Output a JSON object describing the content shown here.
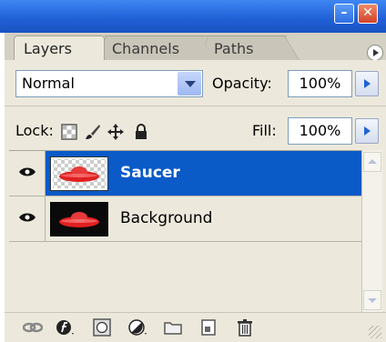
{
  "window": {
    "minimize_glyph": "–",
    "close_glyph": "✕"
  },
  "tabs": [
    {
      "label": "Layers",
      "active": true
    },
    {
      "label": "Channels",
      "active": false
    },
    {
      "label": "Paths",
      "active": false
    }
  ],
  "blend_mode": {
    "value": "Normal"
  },
  "opacity": {
    "label": "Opacity:",
    "value": "100%"
  },
  "lock": {
    "label": "Lock:",
    "icons": [
      "lock-transparent-pixels-icon",
      "lock-image-pixels-icon",
      "lock-position-icon",
      "lock-all-icon"
    ]
  },
  "fill": {
    "label": "Fill:",
    "value": "100%"
  },
  "layers": [
    {
      "name": "Saucer",
      "visible": true,
      "selected": true
    },
    {
      "name": "Background",
      "visible": true,
      "selected": false
    }
  ],
  "toolbar_icons": [
    "link-icon",
    "layer-style-icon",
    "add-mask-icon",
    "adjustment-layer-icon",
    "new-group-icon",
    "new-layer-icon",
    "trash-icon"
  ],
  "colors": {
    "titlebar": "#1f5fd6",
    "selection": "#0a5ac8",
    "panel": "#ece9dc"
  }
}
